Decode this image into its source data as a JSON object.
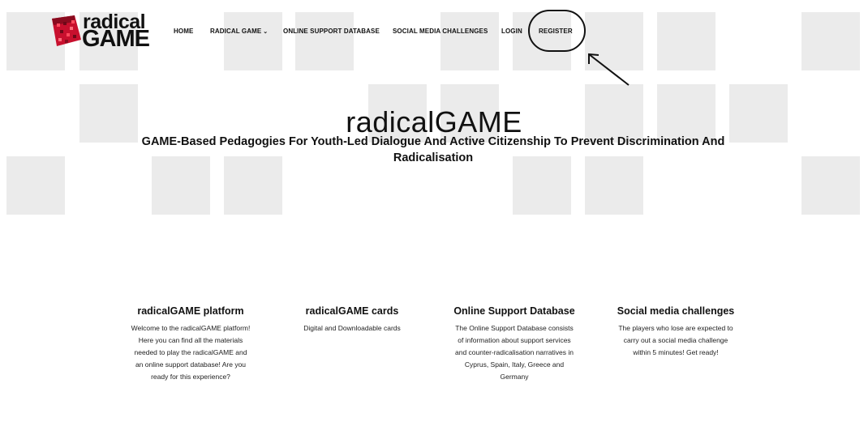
{
  "logo": {
    "line1": "radical",
    "line2": "GAME"
  },
  "nav": {
    "home": "HOME",
    "radical_game": "RADICAL GAME",
    "online_support_database": "ONLINE SUPPORT DATABASE",
    "social_media_challenges": "SOCIAL MEDIA CHALLENGES",
    "login": "LOGIN",
    "register": "REGISTER",
    "dropdown_glyph": "⌄"
  },
  "hero": {
    "title": "radicalGAME",
    "subtitle": "GAME-Based Pedagogies For Youth-Led Dialogue And Active Citizenship To Prevent Discrimination And Radicalisation"
  },
  "features": [
    {
      "title": "radicalGAME platform",
      "text": "Welcome to the radicalGAME platform! Here you can find all the materials needed to play the radicalGAME and an online support database! Are you ready for this experience?"
    },
    {
      "title": "radicalGAME cards",
      "text": "Digital and Downloadable cards"
    },
    {
      "title": "Online Support Database",
      "text": "The Online Support Database consists of information about support services and counter-radicalisation narratives in Cyprus, Spain, Italy, Greece and Germany"
    },
    {
      "title": "Social media challenges",
      "text": "The players who lose are expected to carry out a social media challenge within 5 minutes! Get ready!"
    }
  ],
  "colors": {
    "logo_red": "#c8102e",
    "background_square": "#ebebeb",
    "text": "#111111"
  },
  "icons": {
    "logo_mark": "pixel-mosaic-logo-icon",
    "annotation": "circle-and-arrow-annotation"
  }
}
